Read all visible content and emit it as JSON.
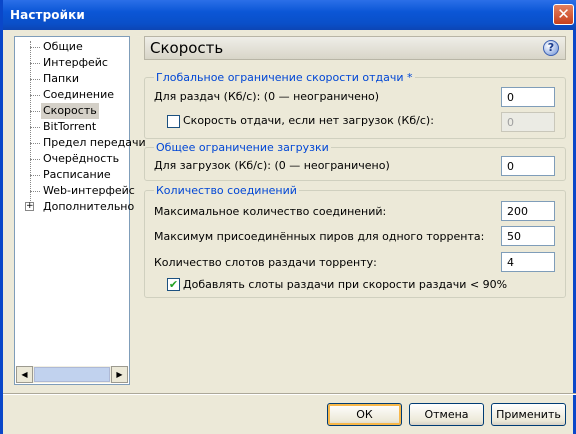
{
  "window": {
    "title": "Настройки",
    "close_glyph": "✕"
  },
  "tree": {
    "items": [
      {
        "label": "Общие"
      },
      {
        "label": "Интерфейс"
      },
      {
        "label": "Папки"
      },
      {
        "label": "Соединение"
      },
      {
        "label": "Скорость",
        "selected": true
      },
      {
        "label": "BitTorrent"
      },
      {
        "label": "Предел передачи"
      },
      {
        "label": "Очерёдность"
      },
      {
        "label": "Расписание"
      },
      {
        "label": "Web-интерфейс"
      },
      {
        "label": "Дополнительно",
        "expander": "+"
      }
    ],
    "scroll_left": "◀",
    "scroll_right": "▶"
  },
  "panel": {
    "title": "Скорость",
    "help_glyph": "?"
  },
  "upload_group": {
    "legend": "Глобальное ограничение скорости отдачи *",
    "rate_label": "Для раздач (Кб/с): (0 — неограничено)",
    "rate_value": "0",
    "alt_checkbox_label": "Скорость отдачи, если нет загрузок (Кб/с):",
    "alt_checked": false,
    "alt_value": "0"
  },
  "download_group": {
    "legend": "Общее ограничение загрузки",
    "rate_label": "Для загрузок (Кб/с): (0 — неограничено)",
    "rate_value": "0"
  },
  "connections_group": {
    "legend": "Количество соединений",
    "max_conn_label": "Максимальное количество соединений:",
    "max_conn_value": "200",
    "max_peers_label": "Максимум присоединённых пиров для одного торрента:",
    "max_peers_value": "50",
    "slots_label": "Количество слотов раздачи торренту:",
    "slots_value": "4",
    "extra_slots_label": "Добавлять слоты раздачи при скорости раздачи < 90%",
    "extra_slots_checked": true,
    "check_glyph": "✔"
  },
  "buttons": {
    "ok": "ОК",
    "cancel": "Отмена",
    "apply": "Применить"
  }
}
